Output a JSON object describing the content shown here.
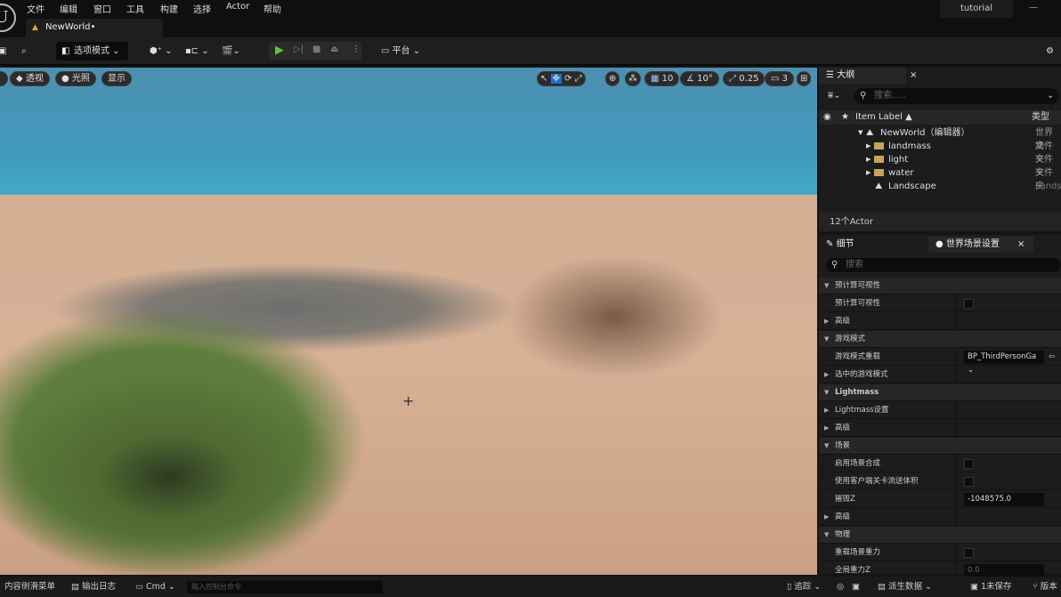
{
  "menubar": {
    "items": [
      "文件",
      "编辑",
      "窗口",
      "工具",
      "构建",
      "选择",
      "Actor",
      "帮助"
    ],
    "project": "tutorial",
    "doc_tab": "NewWorld•"
  },
  "toolbar": {
    "mode": "选项模式",
    "platform": "平台"
  },
  "viewport": {
    "perspective": "透视",
    "lighting": "光照",
    "show": "显示",
    "grid_snap": "10",
    "angle_snap": "10°",
    "scale_snap": "0.25",
    "camera_speed": "3"
  },
  "outliner": {
    "tab": "大纲",
    "search_placeholder": "搜索.....",
    "col_label": "Item Label ▲",
    "col_type": "类型",
    "rows": [
      {
        "label": "NewWorld（编辑器）",
        "type": "世界场"
      },
      {
        "label": "landmass",
        "type": "文件夹"
      },
      {
        "label": "light",
        "type": "文件夹"
      },
      {
        "label": "water",
        "type": "文件夹"
      },
      {
        "label": "Landscape",
        "type": "Landsc"
      }
    ],
    "count": "12个Actor"
  },
  "details": {
    "tab_details": "细节",
    "tab_world": "世界场景设置",
    "search_placeholder": "搜索",
    "rows": [
      {
        "label": "预计算可视性",
        "kind": "cat"
      },
      {
        "label": "预计算可视性",
        "kind": "check"
      },
      {
        "label": "高级",
        "kind": "sub"
      },
      {
        "label": "游戏模式",
        "kind": "cat"
      },
      {
        "label": "游戏模式重载",
        "kind": "combo",
        "value": "BP_ThirdPersonGa"
      },
      {
        "label": "选中的游戏模式",
        "kind": "sub"
      },
      {
        "label": "Lightmass",
        "kind": "cat"
      },
      {
        "label": "Lightmass设置",
        "kind": "sub"
      },
      {
        "label": "高级",
        "kind": "sub"
      },
      {
        "label": "场景",
        "kind": "cat"
      },
      {
        "label": "启用场景合成",
        "kind": "check"
      },
      {
        "label": "使用客户端关卡流送体积",
        "kind": "check"
      },
      {
        "label": "摧毁Z",
        "kind": "field",
        "value": "-1048575.0"
      },
      {
        "label": "高级",
        "kind": "sub"
      },
      {
        "label": "物理",
        "kind": "cat"
      },
      {
        "label": "重载场景重力",
        "kind": "check"
      },
      {
        "label": "全局重力Z",
        "kind": "field",
        "value": "0.0"
      }
    ]
  },
  "statusbar": {
    "content_drawer": "内容侧滑菜单",
    "output_log": "输出日志",
    "cmd": "Cmd",
    "console_placeholder": "输入控制台命令",
    "trace": "追踪",
    "derived_data": "派生数据",
    "unsaved": "1未保存",
    "revision": "版本"
  }
}
